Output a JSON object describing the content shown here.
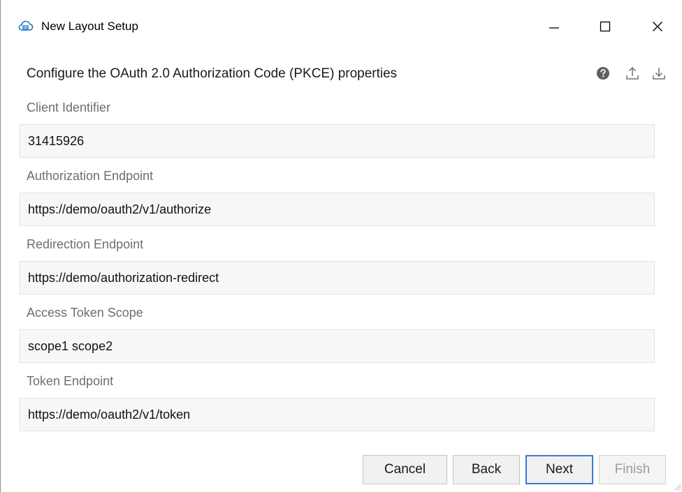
{
  "window": {
    "title": "New Layout Setup",
    "controls": {
      "minimize": "minimize-icon",
      "maximize": "maximize-icon",
      "close": "close-icon"
    }
  },
  "header": {
    "text": "Configure the OAuth 2.0 Authorization Code (PKCE) properties",
    "icons": [
      "help-icon",
      "upload-icon",
      "download-icon"
    ]
  },
  "fields": [
    {
      "label": "Client Identifier",
      "value": "31415926"
    },
    {
      "label": "Authorization Endpoint",
      "value": "https://demo/oauth2/v1/authorize"
    },
    {
      "label": "Redirection Endpoint",
      "value": "https://demo/authorization-redirect"
    },
    {
      "label": "Access Token Scope",
      "value": "scope1 scope2"
    },
    {
      "label": "Token Endpoint",
      "value": "https://demo/oauth2/v1/token"
    }
  ],
  "buttons": {
    "cancel": "Cancel",
    "back": "Back",
    "next": "Next",
    "finish": "Finish"
  },
  "colors": {
    "accent": "#3c79d4",
    "app_icon": "#1e73c8",
    "disabled_text": "#9b9b9b",
    "label_text": "#6e6e6e"
  }
}
